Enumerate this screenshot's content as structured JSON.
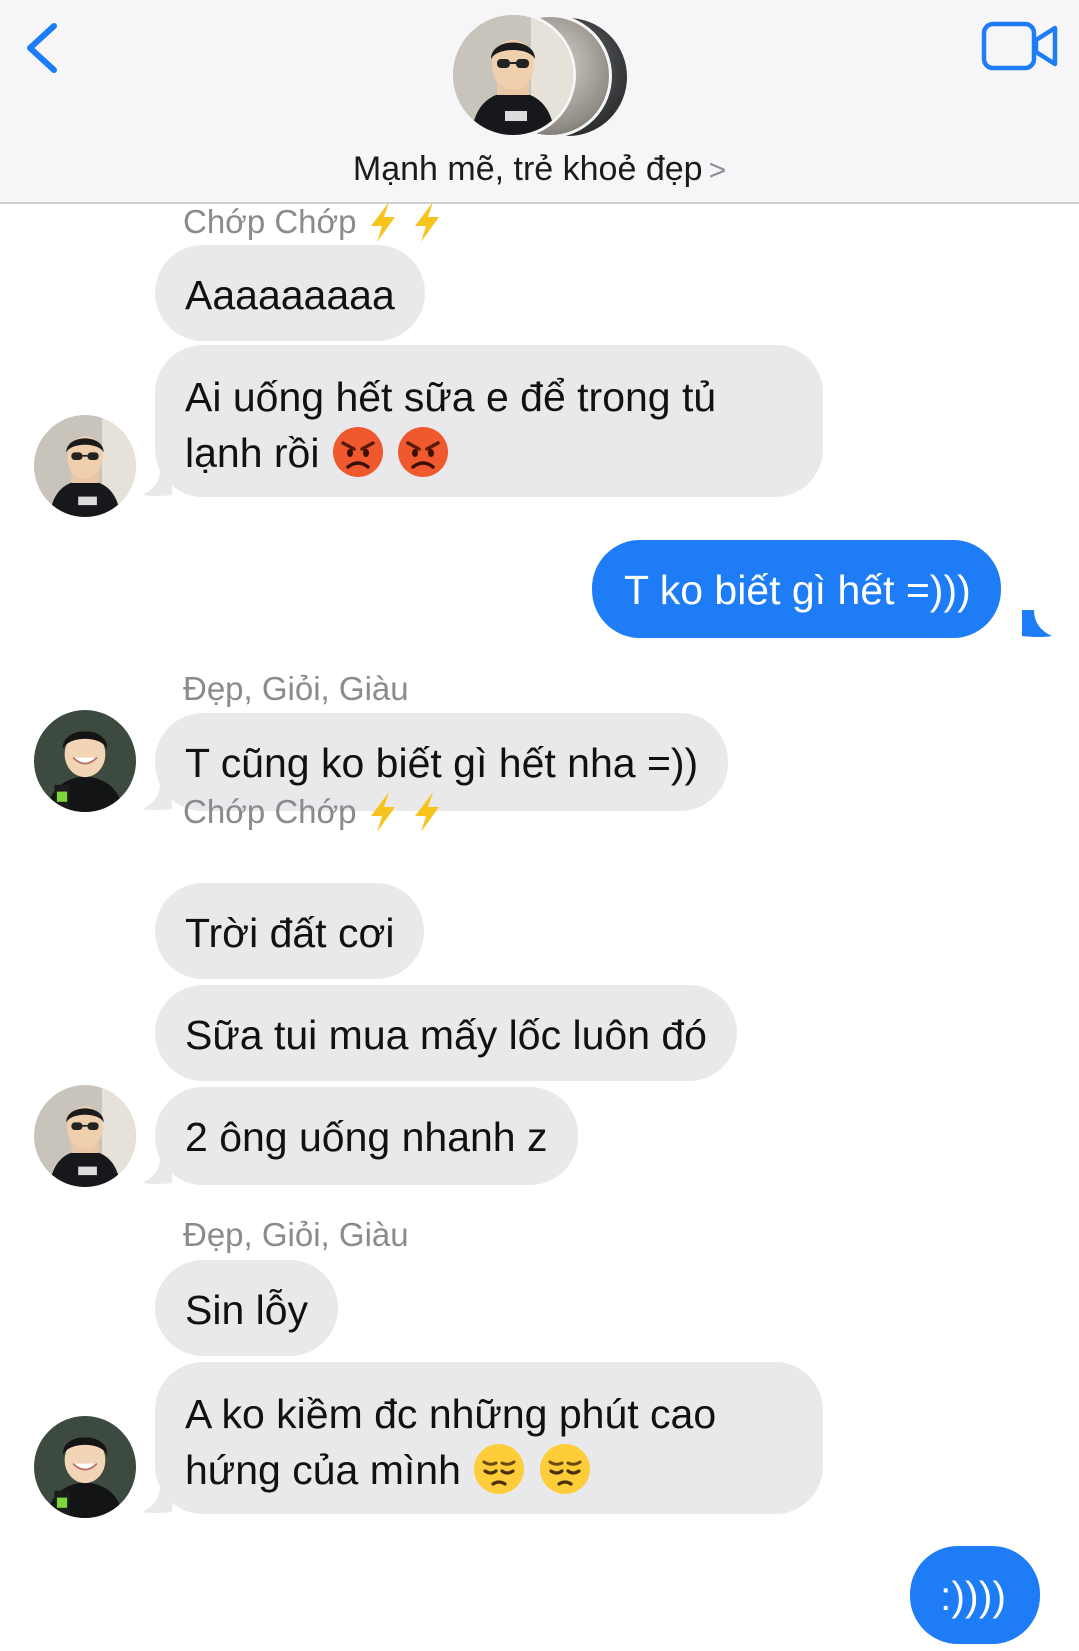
{
  "header": {
    "group_name": "Mạnh mẽ, trẻ khoẻ đẹp",
    "chevron": ">",
    "back_icon": "chevron-left-icon",
    "video_icon": "video-camera-icon",
    "accent_color": "#1e7cf6"
  },
  "messages": [
    {
      "sender": "Chớp Chớp",
      "text": "Aaaaaaaaa",
      "direction": "incoming"
    },
    {
      "line1": "Ai uống hết sữa e để trong tủ",
      "line2": "lạnh rồi",
      "emoji": "angry-face-icon",
      "direction": "incoming"
    },
    {
      "text": "T ko biết gì hết =)))",
      "direction": "outgoing"
    },
    {
      "sender": "Đẹp, Giỏi, Giàu",
      "text": "T cũng ko biết gì hết nha =))",
      "direction": "incoming"
    },
    {
      "sender": "Chớp Chớp",
      "text": "Trời đất cơi",
      "direction": "incoming"
    },
    {
      "text": "Sữa tui mua mấy lốc luôn đó",
      "direction": "incoming"
    },
    {
      "text": "2 ông uống nhanh z",
      "direction": "incoming"
    },
    {
      "sender": "Đẹp, Giỏi, Giàu",
      "text": "Sin lỗy",
      "direction": "incoming"
    },
    {
      "line1": "A ko kiềm đc những phút cao",
      "line2": "hứng của mình",
      "emoji": "pensive-face-icon",
      "direction": "incoming"
    },
    {
      "text": ":))))",
      "direction": "outgoing"
    }
  ],
  "colors": {
    "incoming_bubble": "#e9e9eb",
    "outgoing_bubble": "#1e7cf6",
    "sender_name": "#8a8a8f"
  }
}
